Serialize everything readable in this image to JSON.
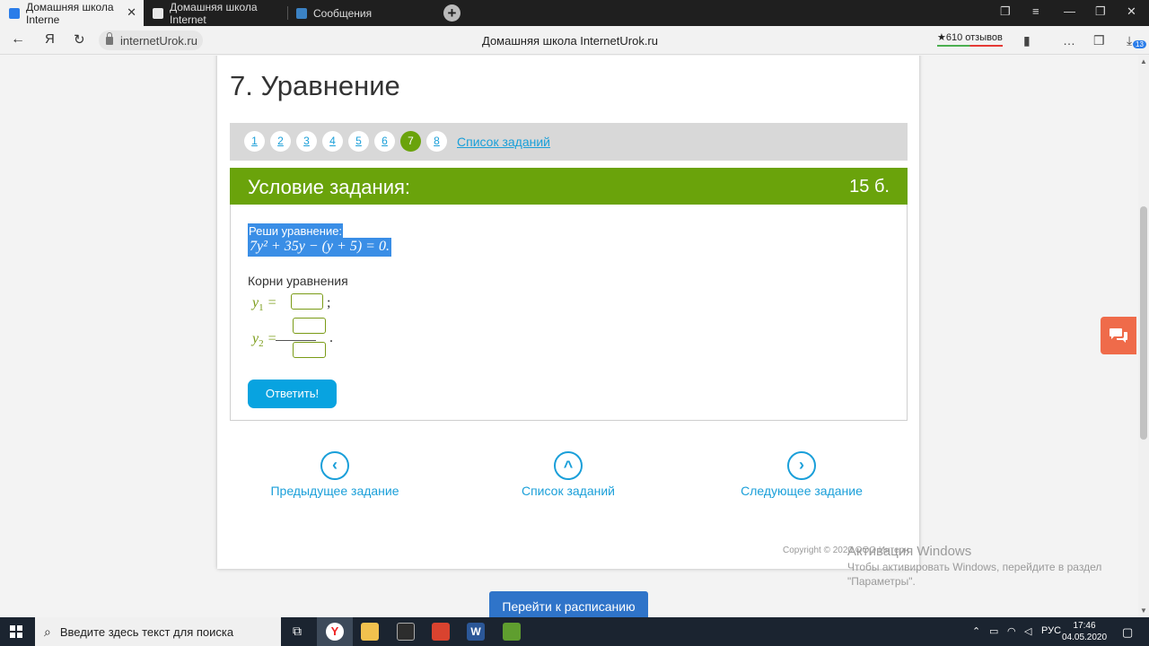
{
  "browser": {
    "tabs": [
      {
        "label": "Домашняя школа Interne",
        "active": true
      },
      {
        "label": "Домашняя школа Internet",
        "active": false
      },
      {
        "label": "Сообщения",
        "active": false
      }
    ],
    "address": "internetUrok.ru",
    "page_title": "Домашняя школа InternetUrok.ru",
    "reviews": "★610 отзывов",
    "notification_count": "13"
  },
  "page": {
    "heading": "7. Уравнение",
    "pager": {
      "numbers": [
        "1",
        "2",
        "3",
        "4",
        "5",
        "6",
        "7",
        "8"
      ],
      "active": "7",
      "list_link": "Список заданий"
    },
    "task": {
      "header": "Условие задания:",
      "points": "15 б.",
      "prompt": "Реши уравнение:",
      "equation": "7y² + 35y − (y + 5) = 0.",
      "roots_label": "Корни уравнения",
      "root1_label": "y",
      "root1_sub": "1",
      "root2_label": "y",
      "root2_sub": "2",
      "answer_button": "Ответить!"
    },
    "nav": {
      "prev": "Предыдущее задание",
      "list": "Список заданий",
      "next": "Следующее задание"
    },
    "copyright": "Copyright © 2020 ООО Интерн",
    "schedule_button": "Перейти к расписанию"
  },
  "watermark": {
    "title": "Активация Windows",
    "line1": "Чтобы активировать Windows, перейдите в раздел",
    "line2": "\"Параметры\"."
  },
  "taskbar": {
    "search_placeholder": "Введите здесь текст для поиска",
    "lang": "РУС",
    "time": "17:46",
    "date": "04.05.2020"
  },
  "colors": {
    "green": "#6aa30b",
    "link_blue": "#1a9fd9",
    "button_blue": "#08a3e0",
    "selection_blue": "#3a8ee6",
    "chat_orange": "#ef6b4a"
  }
}
